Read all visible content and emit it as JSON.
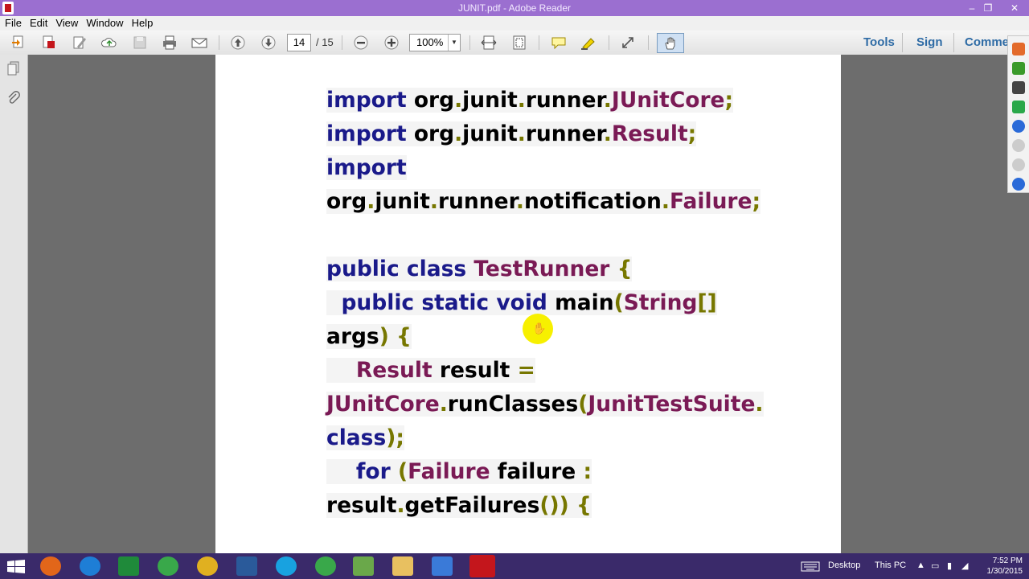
{
  "window": {
    "title": "JUNIT.pdf - Adobe Reader",
    "minimize": "–",
    "restore": "❐",
    "close": "✕"
  },
  "menu": [
    "File",
    "Edit",
    "View",
    "Window",
    "Help"
  ],
  "toolbar": {
    "page_current": "14",
    "page_total": "/ 15",
    "zoom": "100%",
    "zoom_dropdown": "▼",
    "tools_label": "Tools",
    "sign_label": "Sign",
    "comment_label": "Comme"
  },
  "code_lines": [
    [
      {
        "t": "import ",
        "c": "kw"
      },
      {
        "t": "org",
        "c": ""
      },
      {
        "t": ".",
        "c": "pn"
      },
      {
        "t": "junit",
        "c": ""
      },
      {
        "t": ".",
        "c": "pn"
      },
      {
        "t": "runner",
        "c": ""
      },
      {
        "t": ".",
        "c": "pn"
      },
      {
        "t": "JUnitCore",
        "c": "ty"
      },
      {
        "t": ";",
        "c": "pn"
      }
    ],
    [
      {
        "t": "import ",
        "c": "kw"
      },
      {
        "t": "org",
        "c": ""
      },
      {
        "t": ".",
        "c": "pn"
      },
      {
        "t": "junit",
        "c": ""
      },
      {
        "t": ".",
        "c": "pn"
      },
      {
        "t": "runner",
        "c": ""
      },
      {
        "t": ".",
        "c": "pn"
      },
      {
        "t": "Result",
        "c": "ty"
      },
      {
        "t": ";",
        "c": "pn"
      }
    ],
    [
      {
        "t": "import",
        "c": "kw"
      }
    ],
    [
      {
        "t": "org",
        "c": ""
      },
      {
        "t": ".",
        "c": "pn"
      },
      {
        "t": "junit",
        "c": ""
      },
      {
        "t": ".",
        "c": "pn"
      },
      {
        "t": "runner",
        "c": ""
      },
      {
        "t": ".",
        "c": "pn"
      },
      {
        "t": "notification",
        "c": ""
      },
      {
        "t": ".",
        "c": "pn"
      },
      {
        "t": "Failure",
        "c": "ty"
      },
      {
        "t": ";",
        "c": "pn"
      }
    ],
    [],
    [
      {
        "t": "public class ",
        "c": "kw"
      },
      {
        "t": "TestRunner ",
        "c": "ty"
      },
      {
        "t": "{",
        "c": "pn"
      }
    ],
    [
      {
        "t": "  public static void ",
        "c": "kw"
      },
      {
        "t": "main",
        "c": ""
      },
      {
        "t": "(",
        "c": "pn"
      },
      {
        "t": "String",
        "c": "ty"
      },
      {
        "t": "[]",
        "c": "pn"
      }
    ],
    [
      {
        "t": "args",
        "c": ""
      },
      {
        "t": ") {",
        "c": "pn"
      }
    ],
    [
      {
        "t": "    Result ",
        "c": "ty"
      },
      {
        "t": "result ",
        "c": ""
      },
      {
        "t": "=",
        "c": "pn"
      }
    ],
    [
      {
        "t": "JUnitCore",
        "c": "ty"
      },
      {
        "t": ".",
        "c": "pn"
      },
      {
        "t": "runClasses",
        "c": ""
      },
      {
        "t": "(",
        "c": "pn"
      },
      {
        "t": "JunitTestSuite",
        "c": "ty"
      },
      {
        "t": ".",
        "c": "pn"
      }
    ],
    [
      {
        "t": "class",
        "c": "kw"
      },
      {
        "t": ");",
        "c": "pn"
      }
    ],
    [
      {
        "t": "    for ",
        "c": "kw"
      },
      {
        "t": "(",
        "c": "pn"
      },
      {
        "t": "Failure ",
        "c": "ty"
      },
      {
        "t": "failure ",
        "c": ""
      },
      {
        "t": ":",
        "c": "pn"
      }
    ],
    [
      {
        "t": "result",
        "c": ""
      },
      {
        "t": ".",
        "c": "pn"
      },
      {
        "t": "getFailures",
        "c": ""
      },
      {
        "t": "()) {",
        "c": "pn"
      }
    ]
  ],
  "taskbar": {
    "desktop_label": "Desktop",
    "thispc_label": "This PC",
    "time": "7:52 PM",
    "date": "1/30/2015"
  },
  "colors": {
    "titlebar": "#9b6fd0",
    "taskbar": "#3a2a6a",
    "keyword": "#1a1a8a",
    "type": "#7a1a55",
    "punct": "#777700"
  }
}
